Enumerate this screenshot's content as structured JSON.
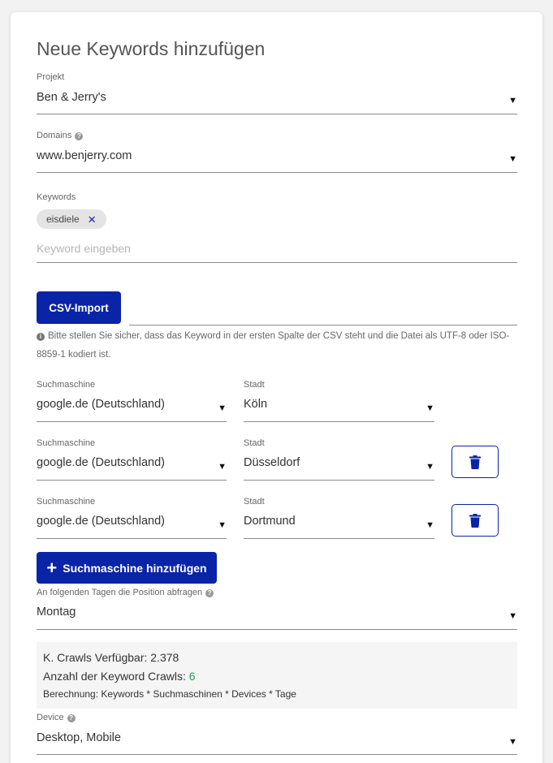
{
  "title": "Neue Keywords hinzufügen",
  "projekt": {
    "label": "Projekt",
    "value": "Ben & Jerry's"
  },
  "domains": {
    "label": "Domains",
    "value": "www.benjerry.com"
  },
  "keywords": {
    "label": "Keywords",
    "chip": "eisdiele",
    "placeholder": "Keyword eingeben"
  },
  "csv": {
    "button": "CSV-Import",
    "info": "Bitte stellen Sie sicher, dass das Keyword in der ersten Spalte der CSV steht und die Datei als UTF-8 oder ISO-8859-1 kodiert ist."
  },
  "engines": [
    {
      "engine_label": "Suchmaschine",
      "engine": "google.de (Deutschland)",
      "city_label": "Stadt",
      "city": "Köln"
    },
    {
      "engine_label": "Suchmaschine",
      "engine": "google.de (Deutschland)",
      "city_label": "Stadt",
      "city": "Düsseldorf"
    },
    {
      "engine_label": "Suchmaschine",
      "engine": "google.de (Deutschland)",
      "city_label": "Stadt",
      "city": "Dortmund"
    }
  ],
  "add_engine_button": "Suchmaschine hinzufügen",
  "days": {
    "label": "An folgenden Tagen die Position abfragen",
    "value": "Montag"
  },
  "summary": {
    "crawls_available": "K. Crawls Verfügbar: 2.378",
    "crawl_count_label": "Anzahl der Keyword Crawls: ",
    "crawl_count": "6",
    "formula": "Berechnung: Keywords * Suchmaschinen * Devices * Tage"
  },
  "device": {
    "label": "Device",
    "value": "Desktop, Mobile"
  },
  "icons": {
    "dropdown": "triangle-down-icon",
    "help": "help-circle-icon",
    "remove": "close-icon",
    "delete": "trash-icon",
    "add": "plus-icon",
    "info": "info-circle-icon"
  },
  "colors": {
    "primary": "#0a24a8",
    "accent_green": "#2a9a5a"
  }
}
